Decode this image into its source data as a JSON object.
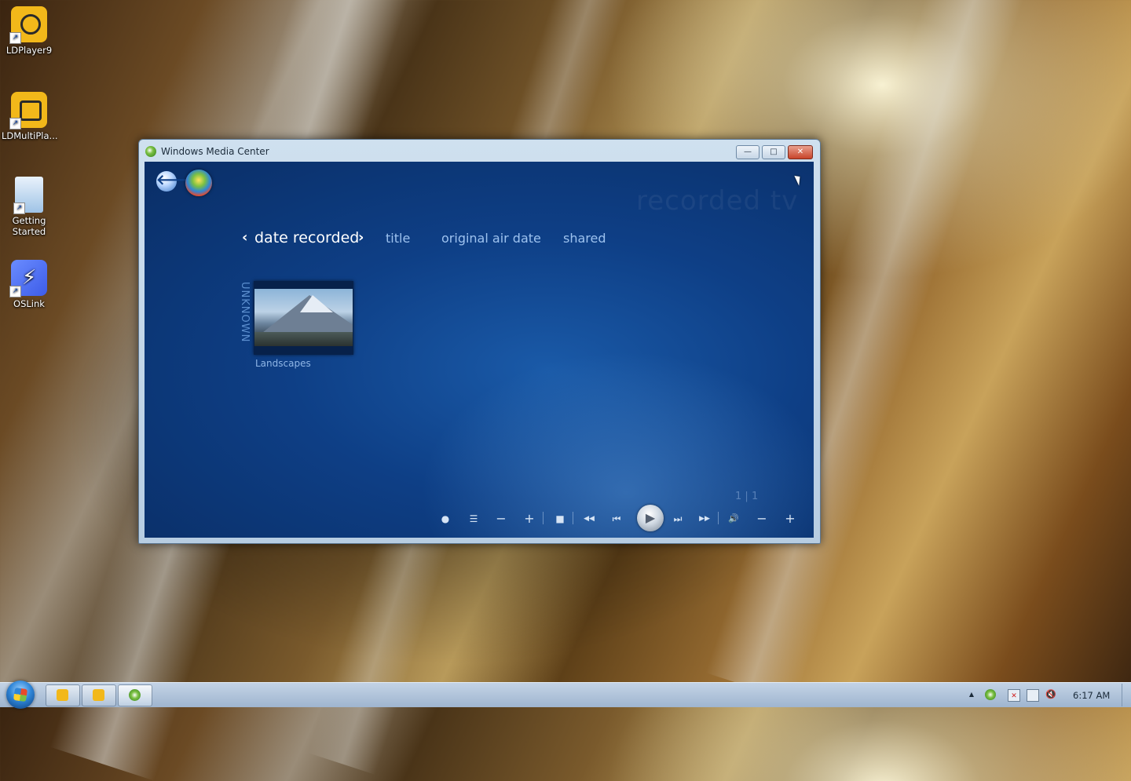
{
  "desktop": {
    "icons": [
      {
        "label": "LDPlayer9",
        "icon": "ldplayer-icon"
      },
      {
        "label": "LDMultiPla...",
        "icon": "ldmultiplayer-icon"
      },
      {
        "label": "Getting Started",
        "icon": "getting-started-icon"
      },
      {
        "label": "OSLink",
        "icon": "oslink-icon"
      }
    ]
  },
  "window": {
    "title": "Windows Media Center",
    "minimize_label": "—",
    "maximize_label": "□",
    "close_label": "✕"
  },
  "media_center": {
    "back_glyph": "🡐",
    "background_title": "recorded tv",
    "sort": {
      "prev_glyph": "‹",
      "next_glyph": "›",
      "options": [
        "date recorded",
        "title",
        "original air date",
        "shared"
      ]
    },
    "group_label": "UNKNOWN",
    "items": [
      {
        "caption": "Landscapes"
      }
    ],
    "pager": {
      "current": "1",
      "separator": "|",
      "total": "1"
    },
    "transport": {
      "record": "●",
      "guide": "☰",
      "channel_down": "−",
      "channel_up": "+",
      "stop": "■",
      "rewind": "◀◀",
      "skip_back": "⏮",
      "play": "▶",
      "skip_forward": "⏭",
      "fast_forward": "▶▶",
      "mute": "🔊",
      "volume_down": "−",
      "volume_up": "+"
    }
  },
  "taskbar": {
    "clock": "6:17 AM",
    "tray_overflow_glyph": "▲"
  },
  "colors": {
    "mc_background": "#0e3f86",
    "sort_active": "#ffffff",
    "sort_inactive": "#9dc2ef",
    "taskbar": "#b1c5dc"
  }
}
